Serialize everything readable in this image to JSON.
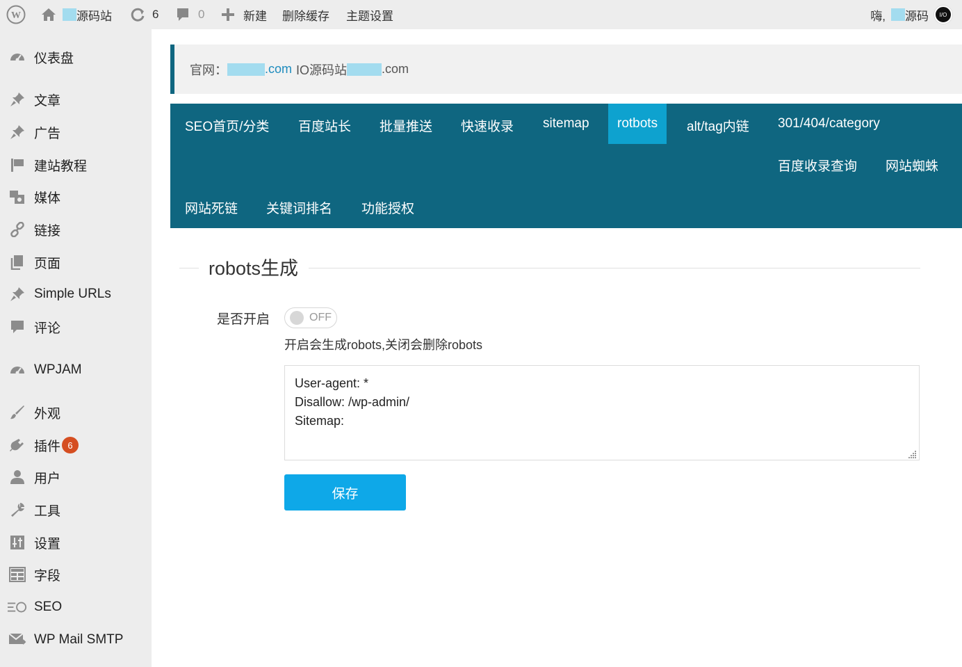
{
  "adminbar": {
    "site_name": "源码站",
    "updates_count": "6",
    "comments_count": "0",
    "new_label": "新建",
    "clear_cache_label": "删除缓存",
    "theme_settings_label": "主题设置",
    "greeting": "嗨,",
    "user_name": "源码",
    "avatar_text": "I/O"
  },
  "sidebar": {
    "items": [
      {
        "label": "仪表盘",
        "icon": "dashboard-icon"
      },
      {
        "label": "文章",
        "icon": "pin-icon"
      },
      {
        "label": "广告",
        "icon": "pin-icon"
      },
      {
        "label": "建站教程",
        "icon": "flag-icon"
      },
      {
        "label": "媒体",
        "icon": "media-icon"
      },
      {
        "label": "链接",
        "icon": "link-icon"
      },
      {
        "label": "页面",
        "icon": "page-icon"
      },
      {
        "label": "Simple URLs",
        "icon": "pin-icon"
      },
      {
        "label": "评论",
        "icon": "comment-icon"
      },
      {
        "label": "WPJAM",
        "icon": "dashboard-icon"
      },
      {
        "label": "外观",
        "icon": "brush-icon"
      },
      {
        "label": "插件",
        "icon": "plugin-icon",
        "badge": "6"
      },
      {
        "label": "用户",
        "icon": "user-icon"
      },
      {
        "label": "工具",
        "icon": "wrench-icon"
      },
      {
        "label": "设置",
        "icon": "settings-icon"
      },
      {
        "label": "字段",
        "icon": "table-icon"
      },
      {
        "label": "SEO",
        "icon": "seo-icon"
      },
      {
        "label": "WP Mail SMTP",
        "icon": "mail-icon"
      }
    ]
  },
  "notice": {
    "prefix": "官网：",
    "link_suffix": ".com",
    "middle": "IO源码站",
    "suffix": ".com"
  },
  "tabs": [
    {
      "label": "SEO首页/分类"
    },
    {
      "label": "百度站长"
    },
    {
      "label": "批量推送"
    },
    {
      "label": "快速收录"
    },
    {
      "label": "sitemap"
    },
    {
      "label": "rotbots",
      "active": true
    },
    {
      "label": "alt/tag内链"
    },
    {
      "label": "301/404/category"
    },
    {
      "label": "百度收录查询"
    },
    {
      "label": "网站蜘蛛"
    },
    {
      "label": "网站死链"
    },
    {
      "label": "关键词排名"
    },
    {
      "label": "功能授权"
    }
  ],
  "section": {
    "title": "robots生成",
    "field_label": "是否开启",
    "toggle_state": "OFF",
    "help_text": "开启会生成robots,关闭会删除robots",
    "robots_content": "User-agent: *\nDisallow: /wp-admin/\nSitemap:",
    "save_label": "保存"
  },
  "colors": {
    "tab_bar": "#0f6680",
    "tab_active": "#0ea2cf",
    "save_button": "#0ea8e8",
    "badge": "#d54e21",
    "sidebar_bg": "#ededed"
  }
}
